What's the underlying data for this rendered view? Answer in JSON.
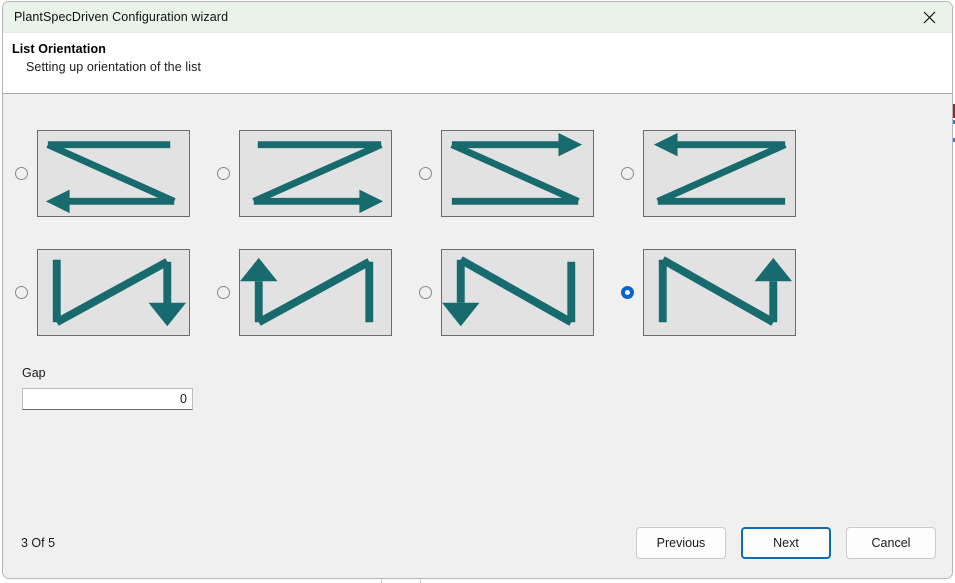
{
  "window": {
    "title": "PlantSpecDriven Configuration wizard",
    "close_icon": "close-icon",
    "titlebar_color": "#eaf3ea"
  },
  "header": {
    "title": "List Orientation",
    "subtitle": "Setting up orientation of the list"
  },
  "orientation": {
    "accent_color": "#176a6e",
    "selected_index": 7,
    "options": [
      {
        "index": 0,
        "name": "horizontal-snake-top-right-to-left",
        "selected": false,
        "icon": "z-shape-top-line-diagonal-down-right-bottom-arrow-left"
      },
      {
        "index": 1,
        "name": "horizontal-snake-top-left-to-right",
        "selected": false,
        "icon": "z-shape-top-line-diagonal-down-left-bottom-arrow-right"
      },
      {
        "index": 2,
        "name": "horizontal-snake-arrow-top-right",
        "selected": false,
        "icon": "z-shape-top-arrow-right-diagonal-down-right-bottom-line"
      },
      {
        "index": 3,
        "name": "horizontal-snake-arrow-top-left",
        "selected": false,
        "icon": "z-shape-top-arrow-left-diagonal-down-left-bottom-line"
      },
      {
        "index": 4,
        "name": "vertical-snake-down-right",
        "selected": false,
        "icon": "n-shape-left-down-diagonal-up-right-arrow-down"
      },
      {
        "index": 5,
        "name": "vertical-snake-up-left",
        "selected": false,
        "icon": "n-shape-left-arrow-up-diagonal-up-right-line"
      },
      {
        "index": 6,
        "name": "vertical-snake-down-left",
        "selected": false,
        "icon": "n-shape-left-arrow-down-diagonal-down-right-up"
      },
      {
        "index": 7,
        "name": "vertical-snake-up-right",
        "selected": true,
        "icon": "n-shape-left-line-diagonal-down-right-arrow-up"
      }
    ]
  },
  "gap": {
    "label": "Gap",
    "value": "0",
    "placeholder": ""
  },
  "footer": {
    "page_indicator": "3 Of 5",
    "previous_label": "Previous",
    "next_label": "Next",
    "cancel_label": "Cancel",
    "focus_color": "#0d6cb4"
  }
}
